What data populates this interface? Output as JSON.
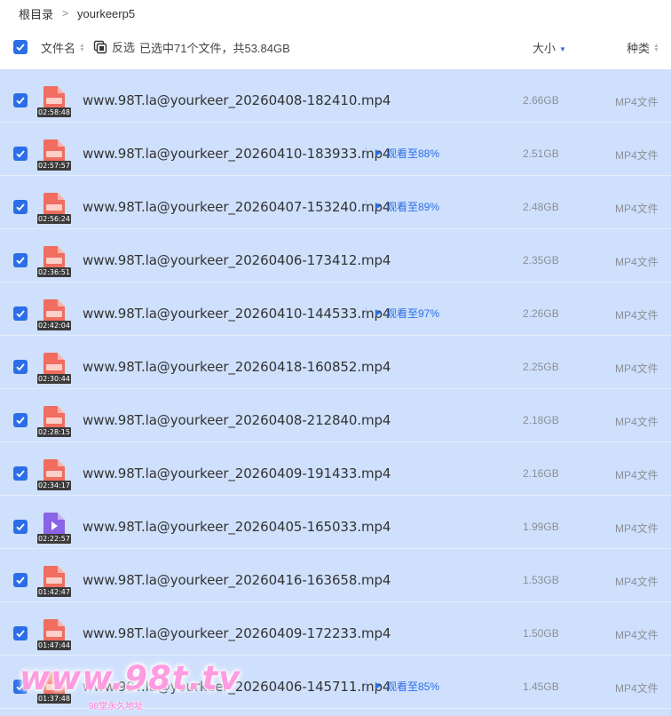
{
  "breadcrumb": {
    "root": "根目录",
    "current": "yourkeerp5"
  },
  "header": {
    "name_label": "文件名",
    "invert_label": "反选",
    "selected_text": "已选中71个文件，共53.84GB",
    "size_label": "大小",
    "type_label": "种类"
  },
  "colors": {
    "accent": "#2b6ee8",
    "selection_bg": "#cfe0fd",
    "thumb_red": "#f06d5f",
    "thumb_purple": "#8a63e6"
  },
  "files": [
    {
      "name": "www.98T.la@yourkeer_20260408-182410.mp4",
      "duration": "02:58:48",
      "watched": "",
      "size": "2.66GB",
      "type": "MP4文件",
      "icon": "video-red"
    },
    {
      "name": "www.98T.la@yourkeer_20260410-183933.mp4",
      "duration": "02:57:57",
      "watched": "观看至88%",
      "size": "2.51GB",
      "type": "MP4文件",
      "icon": "video-red"
    },
    {
      "name": "www.98T.la@yourkeer_20260407-153240.mp4",
      "duration": "02:56:24",
      "watched": "观看至89%",
      "size": "2.48GB",
      "type": "MP4文件",
      "icon": "video-red"
    },
    {
      "name": "www.98T.la@yourkeer_20260406-173412.mp4",
      "duration": "02:36:51",
      "watched": "",
      "size": "2.35GB",
      "type": "MP4文件",
      "icon": "video-red"
    },
    {
      "name": "www.98T.la@yourkeer_20260410-144533.mp4",
      "duration": "02:42:04",
      "watched": "观看至97%",
      "size": "2.26GB",
      "type": "MP4文件",
      "icon": "video-red"
    },
    {
      "name": "www.98T.la@yourkeer_20260418-160852.mp4",
      "duration": "02:30:44",
      "watched": "",
      "size": "2.25GB",
      "type": "MP4文件",
      "icon": "video-red"
    },
    {
      "name": "www.98T.la@yourkeer_20260408-212840.mp4",
      "duration": "02:28:15",
      "watched": "",
      "size": "2.18GB",
      "type": "MP4文件",
      "icon": "video-red"
    },
    {
      "name": "www.98T.la@yourkeer_20260409-191433.mp4",
      "duration": "02:34:17",
      "watched": "",
      "size": "2.16GB",
      "type": "MP4文件",
      "icon": "video-red"
    },
    {
      "name": "www.98T.la@yourkeer_20260405-165033.mp4",
      "duration": "02:22:57",
      "watched": "",
      "size": "1.99GB",
      "type": "MP4文件",
      "icon": "video-purple"
    },
    {
      "name": "www.98T.la@yourkeer_20260416-163658.mp4",
      "duration": "01:42:47",
      "watched": "",
      "size": "1.53GB",
      "type": "MP4文件",
      "icon": "video-red"
    },
    {
      "name": "www.98T.la@yourkeer_20260409-172233.mp4",
      "duration": "01:47:44",
      "watched": "",
      "size": "1.50GB",
      "type": "MP4文件",
      "icon": "video-red"
    },
    {
      "name": "www.98T.la@yourkeer_20260406-145711.mp4",
      "duration": "01:37:48",
      "watched": "观看至85%",
      "size": "1.45GB",
      "type": "MP4文件",
      "icon": "video-red"
    }
  ],
  "watermark": {
    "main": "www.98t.tv",
    "sub": "98堂永久地址"
  }
}
